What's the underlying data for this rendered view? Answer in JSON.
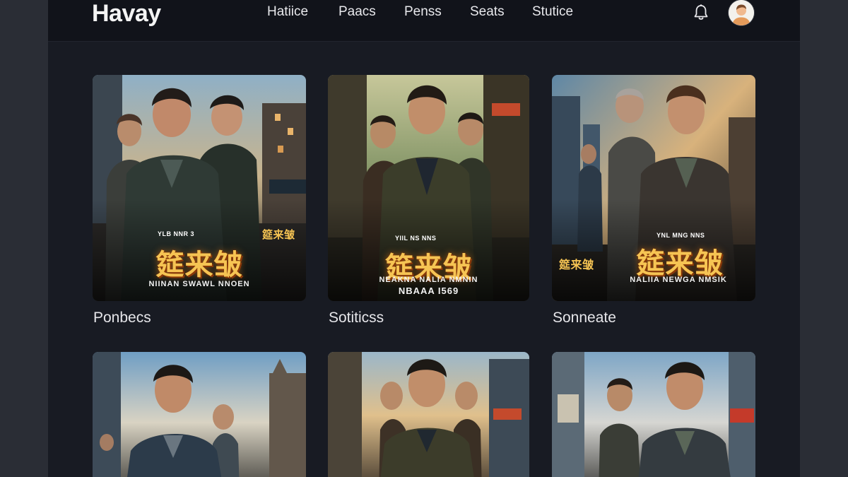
{
  "app": {
    "logo": "Havay",
    "nav": [
      "Hatiice",
      "Paacs",
      "Penss",
      "Seats",
      "Stutice"
    ],
    "accent": "#f6c453"
  },
  "icons": {
    "notifications": "bell-icon",
    "profile": "avatar"
  },
  "posters": [
    {
      "label": "Ponbecs",
      "title": "筵来皱",
      "credits": "NIINAN SWAWL NNOEN",
      "tag_top": "YLB NNR 3",
      "side_title": "筵来皱"
    },
    {
      "label": "Sotiticss",
      "title": "筵来皱",
      "credits": "NEAKNA NALIA NMNIN",
      "credits2": "NBAAA I569",
      "tag_top": "YIIL NS  NNS"
    },
    {
      "label": "Sonneate",
      "title": "筵来皱",
      "credits": "NALIIA NEWGA NMSIK",
      "tag_top": "YNL MNG  NNS",
      "side_title": "筵来皱"
    },
    {
      "label": "",
      "title": ""
    },
    {
      "label": "",
      "title": ""
    },
    {
      "label": "",
      "title": ""
    }
  ]
}
